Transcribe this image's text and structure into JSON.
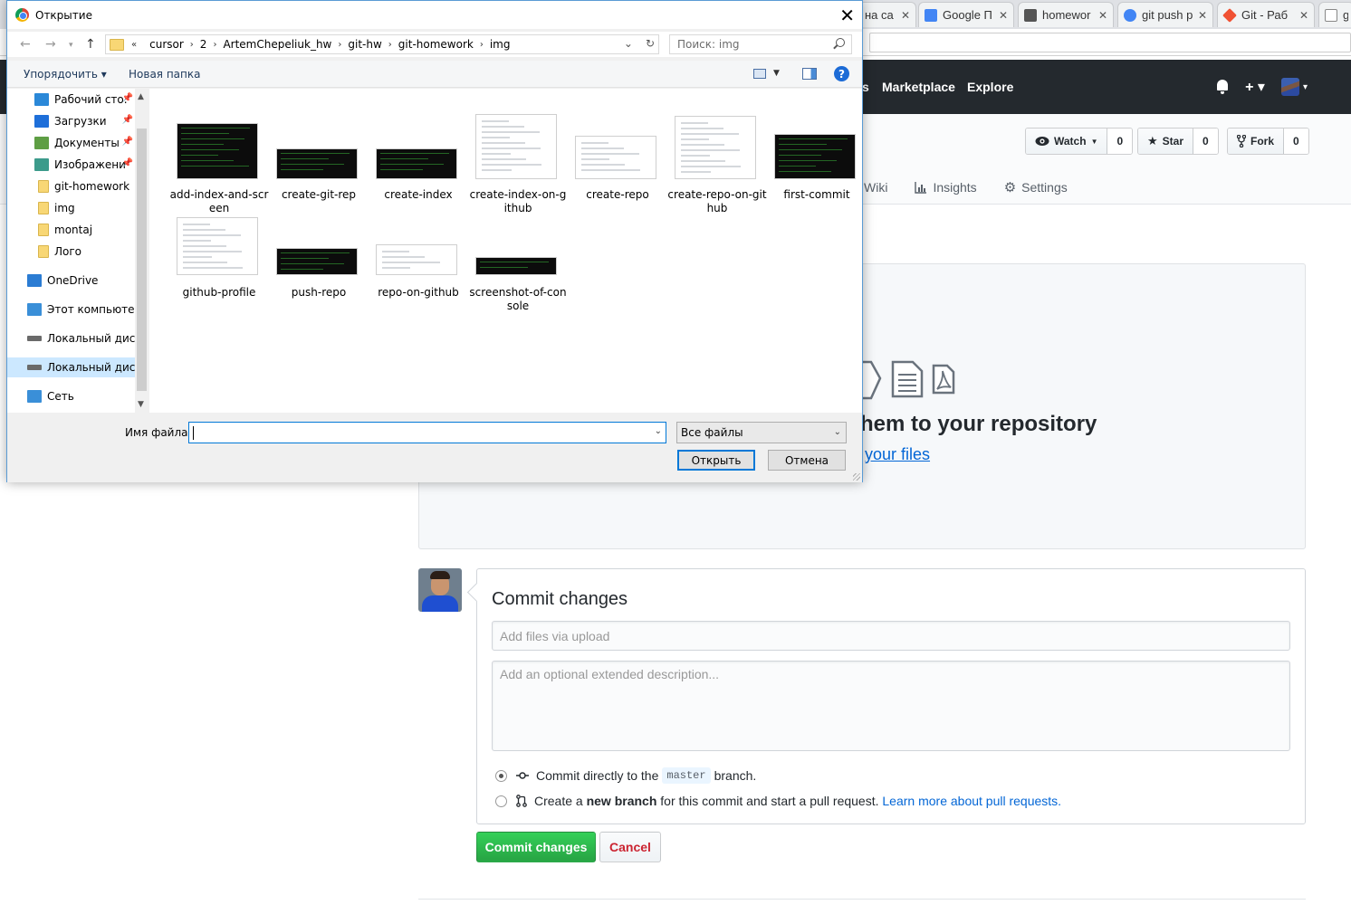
{
  "browser": {
    "tabs": [
      {
        "label": "на са",
        "favicon_color": "#e8e8e8"
      },
      {
        "label": "Google П",
        "favicon_color": "#4285f4"
      },
      {
        "label": "homewor",
        "favicon_color": "#555555"
      },
      {
        "label": "git push р",
        "favicon_color": "#4285f4"
      },
      {
        "label": "Git - Раб",
        "favicon_color": "#f05133"
      },
      {
        "label": "g",
        "favicon_color": "#888888"
      }
    ],
    "tab_close": "✕"
  },
  "github": {
    "nav": {
      "marketplace": "Marketplace",
      "explore": "Explore",
      "partial": "s"
    },
    "header_right": {
      "plus": "+ ▾",
      "avatar_caret": "▾"
    },
    "actions": {
      "watch": {
        "label": "Watch",
        "count": "0"
      },
      "star": {
        "label": "Star",
        "count": "0"
      },
      "fork": {
        "label": "Fork",
        "count": "0"
      }
    },
    "reponav": {
      "wiki": "Wiki",
      "insights": "Insights",
      "settings": "Settings"
    },
    "dropzone": {
      "title": "hem to your repository",
      "link": "your files"
    },
    "commit": {
      "title": "Commit changes",
      "summary_placeholder": "Add files via upload",
      "description_placeholder": "Add an optional extended description...",
      "option_direct": {
        "before": "Commit directly to the",
        "branch": "master",
        "after": "branch."
      },
      "option_new": {
        "before": "Create a",
        "bold": "new branch",
        "middle": "for this commit and start a pull request.",
        "link": "Learn more about pull requests."
      },
      "submit": "Commit changes",
      "cancel": "Cancel"
    },
    "colors": {
      "header": "#24292e",
      "primary_button": "#28a745",
      "link": "#0366d6",
      "cancel_text": "#cb2431"
    }
  },
  "dialog": {
    "title": "Открытие",
    "close": "✕",
    "breadcrumb": [
      "cursor",
      "2",
      "ArtemChepeliuk_hw",
      "git-hw",
      "git-homework",
      "img"
    ],
    "breadcrumb_prefix": "«",
    "search_placeholder": "Поиск: img",
    "commands": {
      "organize": "Упорядочить ▾",
      "new_folder": "Новая папка",
      "help": "?"
    },
    "nav_items": [
      {
        "label": "Рабочий сто.",
        "icon": "desktop-icon",
        "color": "#2b88d8",
        "pinned": true
      },
      {
        "label": "Загрузки",
        "icon": "downloads-icon",
        "color": "#1e6fd9",
        "pinned": true
      },
      {
        "label": "Документы",
        "icon": "documents-icon",
        "color": "#5e9e44",
        "pinned": true
      },
      {
        "label": "Изображени",
        "icon": "pictures-icon",
        "color": "#3c9b8b",
        "pinned": true
      },
      {
        "label": "git-homework",
        "icon": "folder-icon",
        "color": "#f8d775",
        "pinned": false
      },
      {
        "label": "img",
        "icon": "folder-icon",
        "color": "#f8d775",
        "pinned": false
      },
      {
        "label": "montaj",
        "icon": "folder-icon",
        "color": "#f8d775",
        "pinned": false
      },
      {
        "label": "Лого",
        "icon": "folder-icon",
        "color": "#f8d775",
        "pinned": false
      },
      {
        "label": "OneDrive",
        "icon": "onedrive-icon",
        "color": "#2b7cd3",
        "pinned": false
      },
      {
        "label": "Этот компьютер",
        "icon": "computer-icon",
        "color": "#3a8fd8",
        "pinned": false
      },
      {
        "label": "Локальный диск",
        "icon": "disk-icon",
        "color": "#6a6a6a",
        "pinned": false
      },
      {
        "label": "Локальный диск",
        "icon": "disk-icon",
        "color": "#6a6a6a",
        "pinned": false,
        "selected": true
      },
      {
        "label": "Сеть",
        "icon": "network-icon",
        "color": "#3a8fd8",
        "pinned": false
      }
    ],
    "pin_glyph": "📌",
    "files": [
      {
        "name": "add-index-and-screen",
        "thumb": "dark"
      },
      {
        "name": "create-git-rep",
        "thumb": "dark"
      },
      {
        "name": "create-index",
        "thumb": "dark"
      },
      {
        "name": "create-index-on-github",
        "thumb": "light"
      },
      {
        "name": "create-repo",
        "thumb": "light"
      },
      {
        "name": "create-repo-on-github",
        "thumb": "light"
      },
      {
        "name": "first-commit",
        "thumb": "dark"
      },
      {
        "name": "github-profile",
        "thumb": "light"
      },
      {
        "name": "push-repo",
        "thumb": "dark"
      },
      {
        "name": "repo-on-github",
        "thumb": "light"
      },
      {
        "name": "screenshot-of-console",
        "thumb": "dark"
      }
    ],
    "filename_label": "Имя файла:",
    "filename_value": "",
    "filetype": "Все файлы",
    "open_button": "Открыть",
    "cancel_button": "Отмена"
  }
}
